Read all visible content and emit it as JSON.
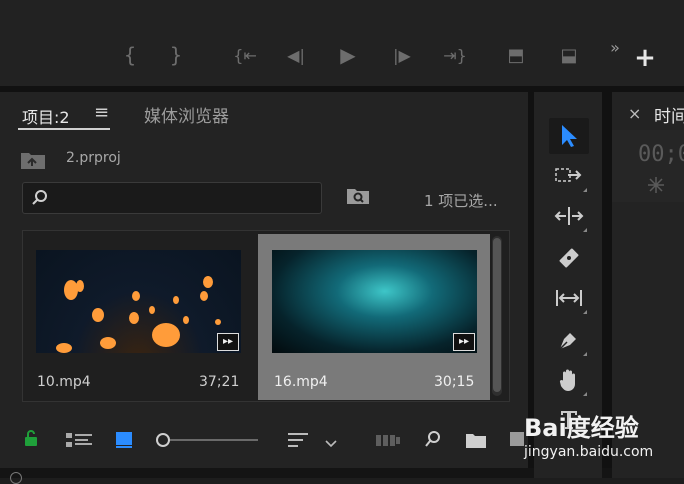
{
  "program_monitor": {
    "controls": [
      {
        "name": "mark-in-icon",
        "glyph": "{"
      },
      {
        "name": "mark-out-icon",
        "glyph": "}"
      },
      {
        "name": "go-to-in-icon",
        "glyph": "{⇤"
      },
      {
        "name": "step-back-icon",
        "glyph": "◀|"
      },
      {
        "name": "play-icon",
        "glyph": "▶"
      },
      {
        "name": "step-forward-icon",
        "glyph": "|▶"
      },
      {
        "name": "go-to-out-icon",
        "glyph": "⇥}"
      },
      {
        "name": "lift-icon",
        "glyph": "⬒"
      },
      {
        "name": "extract-icon",
        "glyph": "⬓"
      }
    ],
    "overflow": "»",
    "add": "+"
  },
  "project_panel": {
    "tab_label": "项目:2",
    "menu_glyph": "≡",
    "media_browser_label": "媒体浏览器",
    "project_file": "2.prproj",
    "search_placeholder": "",
    "selection_status": "1 项已选...",
    "items": [
      {
        "name": "10.mp4",
        "duration": "37;21",
        "selected": false
      },
      {
        "name": "16.mp4",
        "duration": "30;15",
        "selected": true
      }
    ]
  },
  "timeline_panel": {
    "close": "×",
    "title": "时间",
    "timecode": "00;0"
  },
  "tools": [
    {
      "name": "selection-tool-icon",
      "active": true
    },
    {
      "name": "track-select-tool-icon",
      "active": false
    },
    {
      "name": "ripple-edit-tool-icon",
      "active": false
    },
    {
      "name": "razor-tool-icon",
      "active": false
    },
    {
      "name": "slip-tool-icon",
      "active": false
    },
    {
      "name": "pen-tool-icon",
      "active": false
    },
    {
      "name": "hand-tool-icon",
      "active": false
    },
    {
      "name": "type-tool-icon",
      "active": false
    }
  ],
  "bottom_bar": {
    "icons": [
      "lock-icon",
      "list-view-icon",
      "icon-view-icon",
      "zoom-slider",
      "sort-icon",
      "dropdown-icon",
      "automate-icon",
      "find-icon",
      "new-bin-icon",
      "new-item-icon"
    ]
  },
  "watermark": {
    "brand": "Bai度经验",
    "url": "jingyan.baidu.com"
  },
  "colors": {
    "background": "#1d1d1d",
    "panel": "#232323",
    "accent_blue": "#2b8cff",
    "lock_green": "#1fa03a",
    "selected_card": "#7a7a7a"
  }
}
